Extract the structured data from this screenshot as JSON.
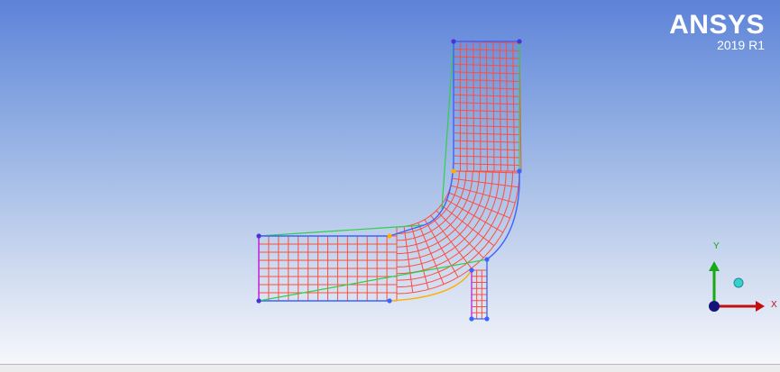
{
  "app": {
    "brand": "ANSYS",
    "version": "2019 R1"
  },
  "triad": {
    "x_label": "X",
    "y_label": "Y"
  },
  "colors": {
    "mesh_line": "#ff4d3d",
    "edge_blue": "#3b63ff",
    "edge_green": "#2fd04a",
    "edge_magenta": "#c020e0",
    "edge_orange": "#ffae00",
    "vertex": "#4a33d6",
    "axis_x": "#c11010",
    "axis_y": "#18a818",
    "axis_z": "#141478",
    "triad_ball": "#35d0cf"
  }
}
